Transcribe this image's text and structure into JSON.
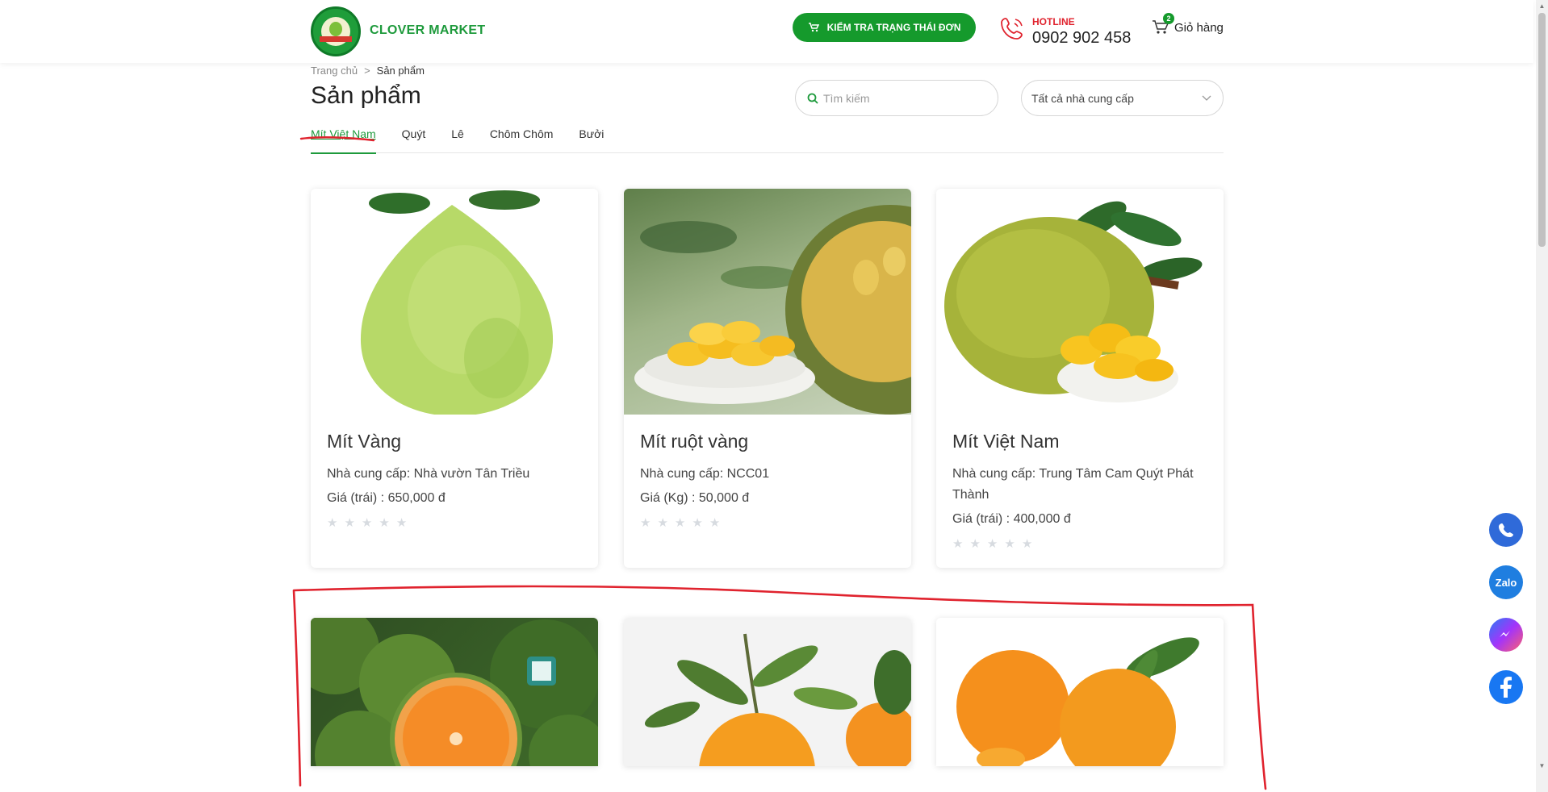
{
  "header": {
    "brand": "CLOVER MARKET",
    "check_order_label": "KIỂM TRA TRẠNG THÁI ĐƠN",
    "hotline_label": "HOTLINE",
    "hotline_number": "0902 902 458",
    "cart_label": "Giỏ hàng",
    "cart_count": "2"
  },
  "breadcrumb": {
    "home": "Trang chủ",
    "separator": ">",
    "current": "Sản phẩm"
  },
  "page": {
    "title": "Sản phẩm",
    "search_placeholder": "Tìm kiếm",
    "supplier_filter": "Tất cả nhà cung cấp"
  },
  "tabs": [
    "Mít Việt Nam",
    "Quýt",
    "Lê",
    "Chôm Chôm",
    "Bưởi"
  ],
  "products": [
    {
      "name": "Mít Vàng",
      "supplier": "Nhà cung cấp: Nhà vườn Tân Triều",
      "price": "Giá (trái) : 650,000 đ"
    },
    {
      "name": "Mít ruột vàng",
      "supplier": "Nhà cung cấp: NCC01",
      "price": "Giá (Kg) : 50,000 đ"
    },
    {
      "name": "Mít Việt Nam",
      "supplier": "Nhà cung cấp: Trung Tâm Cam Quýt Phát Thành",
      "price": "Giá (trái) : 400,000 đ"
    }
  ],
  "rating_stars": "★",
  "floating": {
    "zalo_label": "Zalo"
  },
  "colors": {
    "brand_green": "#159a2c",
    "hotline_red": "#e0232e",
    "annotation_red": "#e0232e"
  }
}
